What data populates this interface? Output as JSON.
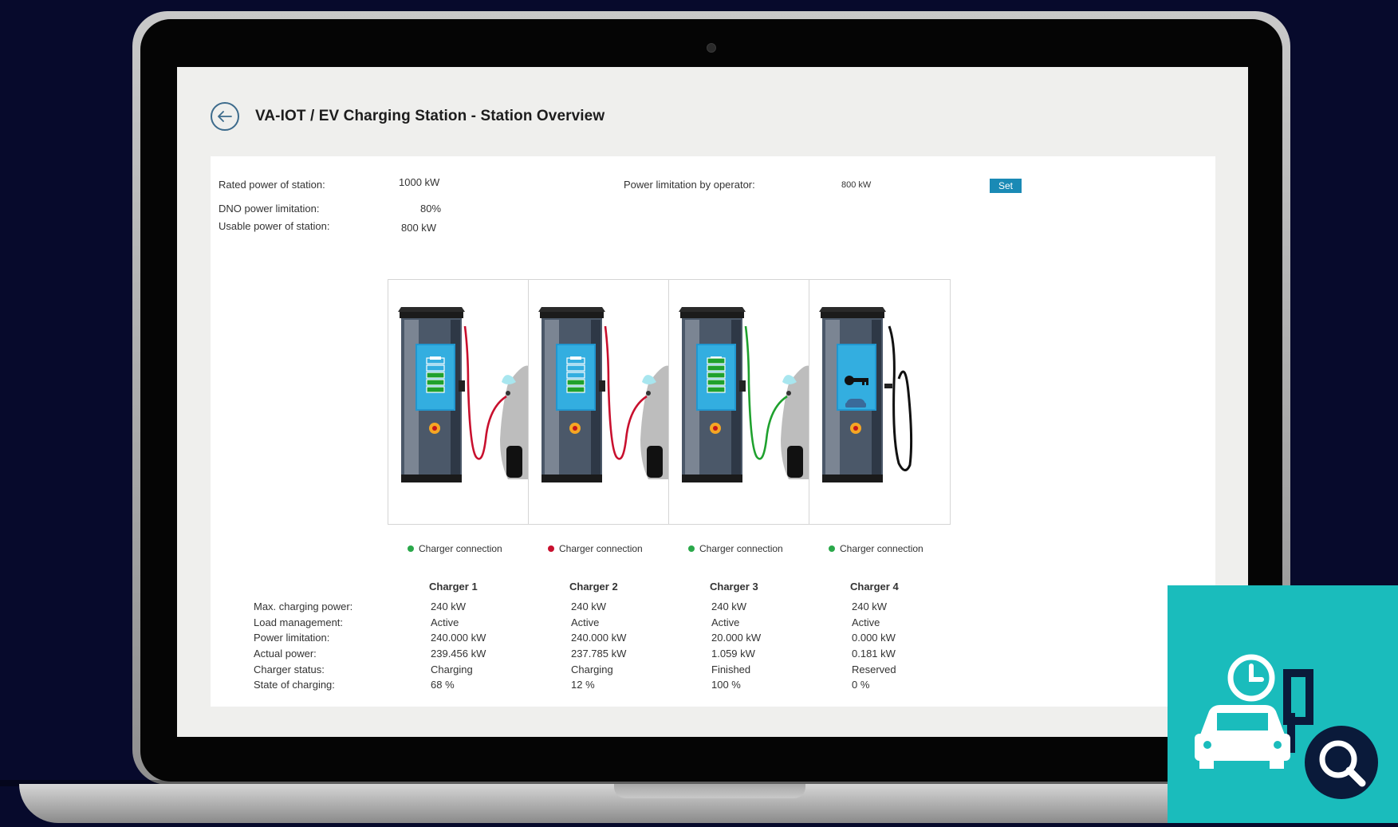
{
  "header": {
    "title": "VA-IOT / EV Charging Station - Station Overview"
  },
  "station": {
    "rated_power_label": "Rated power of station:",
    "rated_power_value": "1000 kW",
    "dno_label": "DNO power limitation:",
    "dno_value": "80%",
    "usable_label": "Usable power of station:",
    "usable_value": "800 kW",
    "operator_limit_label": "Power limitation by operator:",
    "operator_limit_value": "800 kW",
    "set_button": "Set"
  },
  "row_labels": {
    "max_power": "Max. charging power:",
    "load_mgmt": "Load management:",
    "power_limit": "Power limitation:",
    "actual_power": "Actual power:",
    "status": "Charger status:",
    "soc": "State of charging:"
  },
  "chargers": [
    {
      "name": "Charger 1",
      "connection": "Charger connection",
      "connection_color": "#2aa84a",
      "max_power": "240 kW",
      "load_mgmt": "Active",
      "power_limit": "240.000 kW",
      "actual_power": "239.456 kW",
      "status": "Charging",
      "soc": "68 %",
      "soc_fraction": 0.68,
      "cable_color": "#c8102e"
    },
    {
      "name": "Charger 2",
      "connection": "Charger connection",
      "connection_color": "#c8102e",
      "max_power": "240 kW",
      "load_mgmt": "Active",
      "power_limit": "240.000 kW",
      "actual_power": "237.785 kW",
      "status": "Charging",
      "soc": "12 %",
      "soc_fraction": 0.12,
      "cable_color": "#c8102e"
    },
    {
      "name": "Charger 3",
      "connection": "Charger connection",
      "connection_color": "#2aa84a",
      "max_power": "240 kW",
      "load_mgmt": "Active",
      "power_limit": "20.000 kW",
      "actual_power": "1.059 kW",
      "status": "Finished",
      "soc": "100 %",
      "soc_fraction": 1.0,
      "cable_color": "#1fa12e"
    },
    {
      "name": "Charger 4",
      "connection": "Charger connection",
      "connection_color": "#2aa84a",
      "max_power": "240 kW",
      "load_mgmt": "Active",
      "power_limit": "0.000 kW",
      "actual_power": "0.181 kW",
      "status": "Reserved",
      "soc": "0 %",
      "soc_fraction": 0.0,
      "cable_color": "#111111"
    }
  ],
  "icons": {
    "back": "arrow-left-icon",
    "badge": "ev-charging-search-icon"
  },
  "colors": {
    "accent": "#1a8ab5",
    "badge": "#1abcbc",
    "background": "#070a2c"
  }
}
